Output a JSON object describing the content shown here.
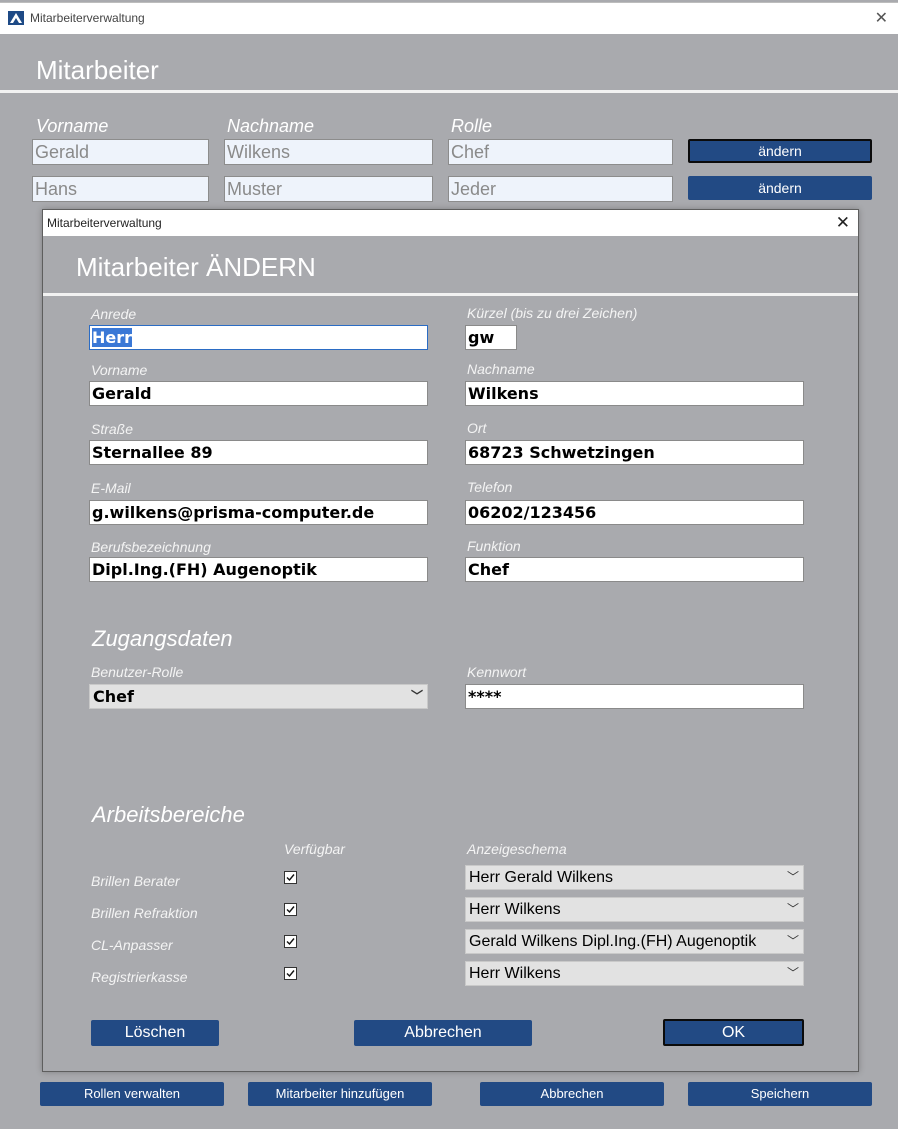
{
  "window": {
    "title": "Mitarbeiterverwaltung"
  },
  "page_title": "Mitarbeiter",
  "columns": {
    "vorname": "Vorname",
    "nachname": "Nachname",
    "rolle": "Rolle"
  },
  "employees": [
    {
      "vorname": "Gerald",
      "nachname": "Wilkens",
      "rolle": "Chef",
      "button": "ändern"
    },
    {
      "vorname": "Hans",
      "nachname": "Muster",
      "rolle": "Jeder",
      "button": "ändern"
    }
  ],
  "dialog": {
    "window_title": "Mitarbeiterverwaltung",
    "heading": "Mitarbeiter ÄNDERN",
    "fields": {
      "anrede": {
        "label": "Anrede",
        "value": "Herr"
      },
      "kuerzel": {
        "label": "Kürzel (bis zu drei Zeichen)",
        "value": "gw"
      },
      "vorname": {
        "label": "Vorname",
        "value": "Gerald"
      },
      "nachname": {
        "label": "Nachname",
        "value": "Wilkens"
      },
      "strasse": {
        "label": "Straße",
        "value": "Sternallee 89"
      },
      "ort": {
        "label": "Ort",
        "value": "68723 Schwetzingen"
      },
      "email": {
        "label": "E-Mail",
        "value": "g.wilkens@prisma-computer.de"
      },
      "telefon": {
        "label": "Telefon",
        "value": "06202/123456"
      },
      "beruf": {
        "label": "Berufsbezeichnung",
        "value": "Dipl.Ing.(FH) Augenoptik"
      },
      "funktion": {
        "label": "Funktion",
        "value": "Chef"
      }
    },
    "zugang": {
      "heading": "Zugangsdaten",
      "rolle_label": "Benutzer-Rolle",
      "rolle_value": "Chef",
      "kennwort_label": "Kennwort",
      "kennwort_value": "****"
    },
    "arbeitsbereiche": {
      "heading": "Arbeitsbereiche",
      "col_available": "Verfügbar",
      "col_schema": "Anzeigeschema",
      "rows": [
        {
          "name": "Brillen Berater",
          "checked": true,
          "schema": "Herr Gerald Wilkens"
        },
        {
          "name": "Brillen Refraktion",
          "checked": true,
          "schema": "Herr Wilkens"
        },
        {
          "name": "CL-Anpasser",
          "checked": true,
          "schema": "Gerald Wilkens Dipl.Ing.(FH) Augenoptik"
        },
        {
          "name": "Registrierkasse",
          "checked": true,
          "schema": "Herr Wilkens"
        }
      ]
    },
    "buttons": {
      "delete": "Löschen",
      "cancel": "Abbrechen",
      "ok": "OK"
    }
  },
  "bottom_buttons": {
    "roles": "Rollen verwalten",
    "add": "Mitarbeiter hinzufügen",
    "cancel": "Abbrechen",
    "save": "Speichern"
  },
  "colors": {
    "accent": "#224a84",
    "background": "#a9aaae"
  }
}
